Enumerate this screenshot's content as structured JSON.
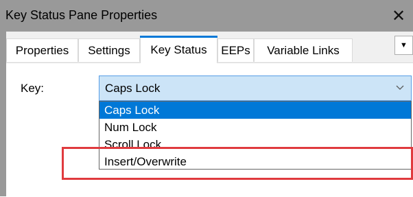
{
  "window": {
    "title": "Key Status Pane Properties",
    "close_glyph": "✕"
  },
  "tabs": [
    {
      "label": "Properties",
      "active": false
    },
    {
      "label": "Settings",
      "active": false
    },
    {
      "label": "Key Status",
      "active": true
    },
    {
      "label": "EEPs",
      "active": false
    },
    {
      "label": "Variable Links",
      "active": false
    }
  ],
  "tab_scroll_glyph": "▼",
  "key_field": {
    "label": "Key:",
    "value": "Caps Lock",
    "options": [
      "Caps Lock",
      "Num Lock",
      "Scroll Lock",
      "Insert/Overwrite"
    ],
    "selected_index": 0
  },
  "colors": {
    "titlebar": "#999999",
    "accent": "#0078d7",
    "annotation_red": "#e03a3e"
  }
}
